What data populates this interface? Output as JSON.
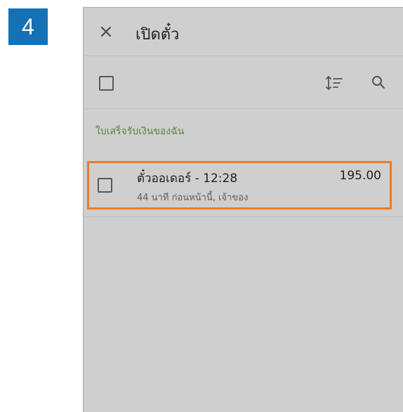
{
  "step_badge": "4",
  "panel": {
    "title": "เปิดตั๋ว",
    "section_header": "ใบเสร็จรับเงินของฉัน",
    "tickets": [
      {
        "name": "ตั๋วออเดอร์ - 12:28",
        "subtitle": "44 นาที ก่อนหน้านี้, เจ้าของ",
        "amount": "195.00"
      }
    ]
  },
  "icons": {
    "close": "close-icon",
    "select_all": "checkbox-icon",
    "sort": "sort-icon",
    "search": "search-icon"
  },
  "colors": {
    "badge": "#1670b4",
    "panel_bg": "#cfcfcf",
    "section_header": "#54883c",
    "highlight": "#ef7a25"
  }
}
